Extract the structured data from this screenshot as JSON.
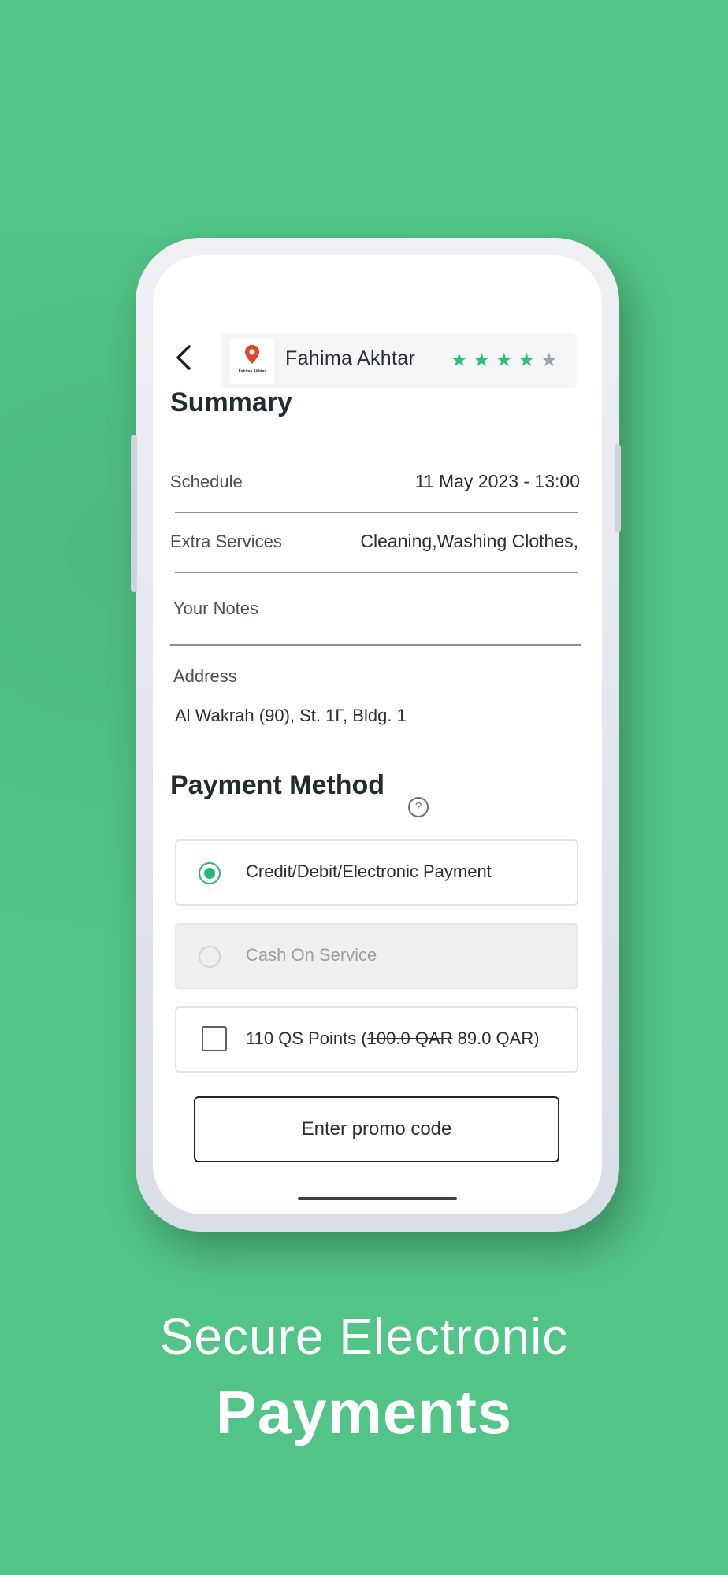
{
  "header": {
    "back_icon": "chevron-left-icon",
    "provider_name": "Fahima Akhtar",
    "provider_logo_text": "Fahima Akhtar",
    "rating": 4,
    "rating_max": 5,
    "star_colors": {
      "filled": "#2fbf7a",
      "empty": "#9aa1a9"
    }
  },
  "summary": {
    "title": "Summary",
    "schedule_label": "Schedule",
    "schedule_value": "11 May 2023 - 13:00",
    "extra_services_label": "Extra Services",
    "extra_services_value": "Cleaning,Washing Clothes,",
    "notes_label": "Your Notes",
    "address_label": "Address",
    "address_value": "Al Wakrah (90), St. 1Γ, Bldg. 1"
  },
  "payment": {
    "title": "Payment Method",
    "help_icon": "question-circle-icon",
    "options": [
      {
        "label": "Credit/Debit/Electronic Payment",
        "selected": true,
        "disabled": false
      },
      {
        "label": "Cash On Service",
        "selected": false,
        "disabled": true
      }
    ],
    "points": {
      "prefix": "110 QS Points (",
      "old_price": "100.0 QAR",
      "new_price": " 89.0 QAR)",
      "checked": false
    },
    "promo_button": "Enter promo code"
  },
  "caption": {
    "line1": "Secure Electronic",
    "line2": "Payments"
  },
  "colors": {
    "background": "#52c487",
    "accent": "#28b873"
  }
}
